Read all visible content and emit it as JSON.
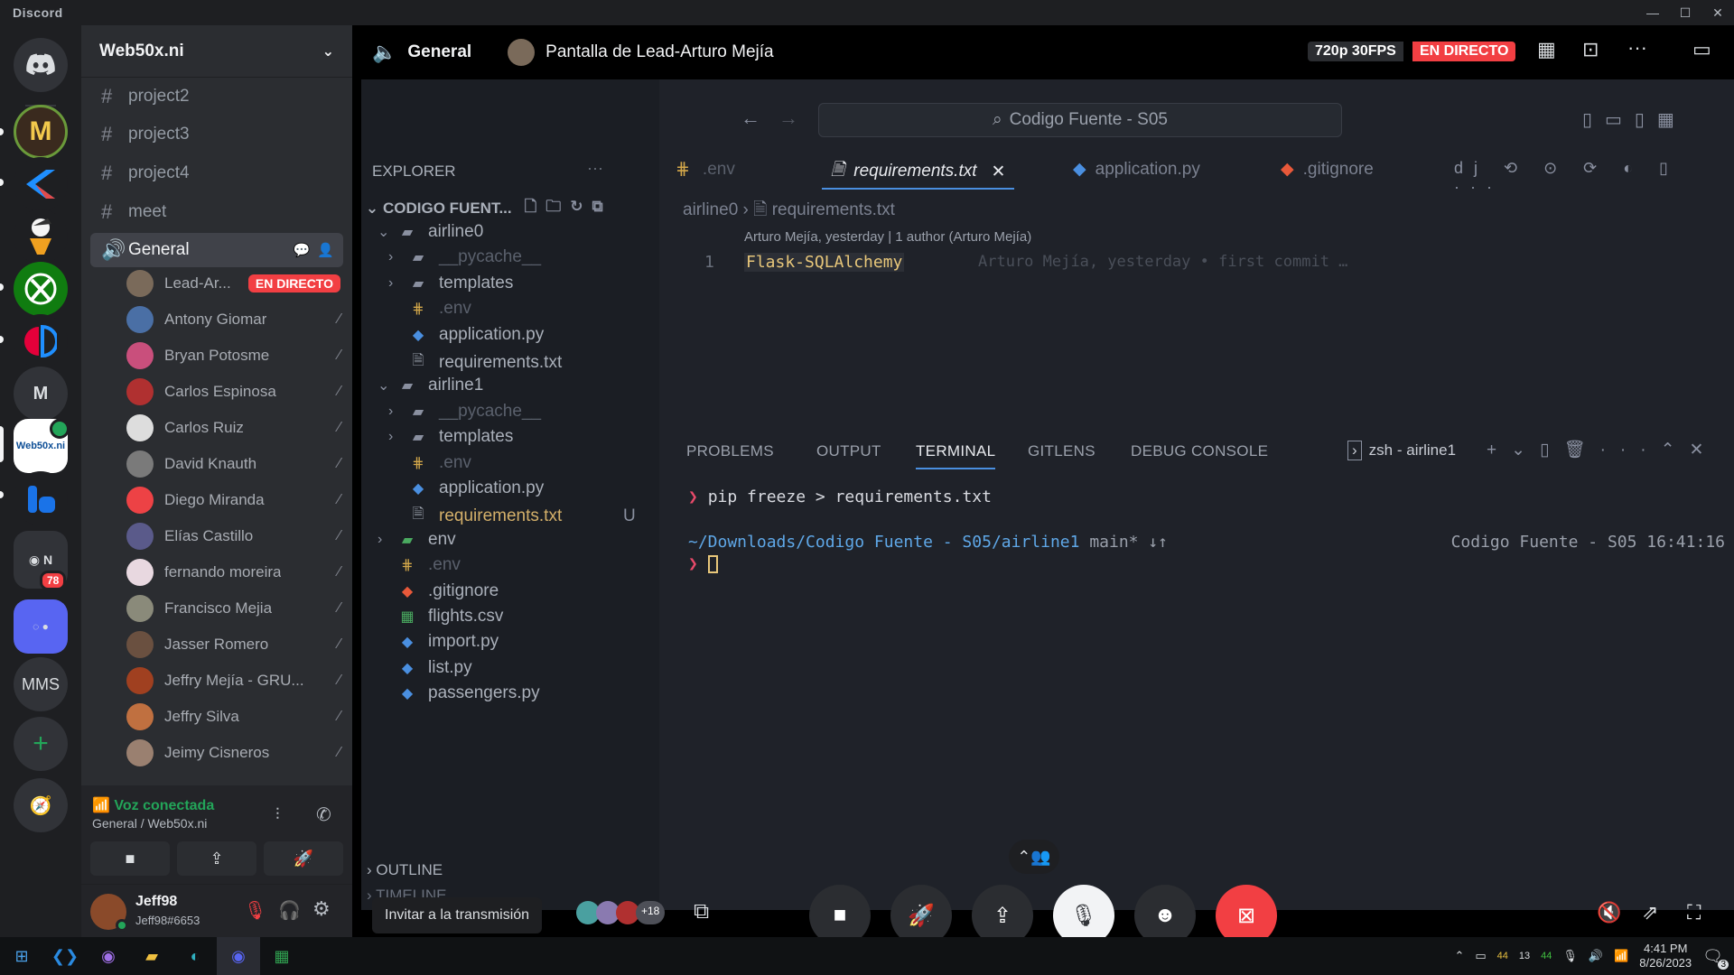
{
  "app": {
    "title": "Discord"
  },
  "guilds": {
    "items": [
      {
        "label": "",
        "color": "#5865f2"
      },
      {
        "label": "M",
        "color": "#2b2d31"
      },
      {
        "label": "",
        "color": "#1f6feb"
      },
      {
        "label": "",
        "color": "#f5f5f5"
      },
      {
        "label": "",
        "color": "#107c10"
      },
      {
        "label": "",
        "color": "#e4003a"
      },
      {
        "label": "M",
        "color": "#313338"
      },
      {
        "label": "Web50x.ni",
        "color": "#ffffff"
      },
      {
        "label": "",
        "color": "#1a73e8"
      },
      {
        "label": "",
        "color": "#313338"
      },
      {
        "label": "",
        "color": "#5865f2"
      },
      {
        "label": "MMS",
        "color": "#313338"
      }
    ],
    "folder_badge": "78"
  },
  "server": {
    "name": "Web50x.ni",
    "text_channels": [
      "project2",
      "project3",
      "project4",
      "meet"
    ],
    "voice_channel": "General",
    "voice_users": [
      {
        "name": "Lead-Ar...",
        "live": "EN DIRECTO",
        "color": "#7a6a5a"
      },
      {
        "name": "Antony Giomar",
        "color": "#4a6fa5"
      },
      {
        "name": "Bryan Potosme",
        "color": "#c94f7c"
      },
      {
        "name": "Carlos Espinosa",
        "color": "#b03030"
      },
      {
        "name": "Carlos Ruiz",
        "color": "#dddddd"
      },
      {
        "name": "David Knauth",
        "color": "#7a7a7a"
      },
      {
        "name": "Diego Miranda",
        "color": "#ed4245"
      },
      {
        "name": "Elías Castillo",
        "color": "#5a5a8a"
      },
      {
        "name": "fernando moreira",
        "color": "#e8d8e0"
      },
      {
        "name": "Francisco Mejia",
        "color": "#8a8a7a"
      },
      {
        "name": "Jasser Romero",
        "color": "#6a5040"
      },
      {
        "name": "Jeffry Mejía - GRU...",
        "color": "#a04020"
      },
      {
        "name": "Jeffry Silva",
        "color": "#c07040"
      },
      {
        "name": "Jeimy Cisneros",
        "color": "#9a8070"
      }
    ]
  },
  "voice_panel": {
    "status": "Voz conectada",
    "location": "General / Web50x.ni"
  },
  "user": {
    "name": "Jeff98",
    "tag": "Jeff98#6653"
  },
  "stream_header": {
    "channel": "General",
    "title": "Pantalla de Lead-Arturo Mejía",
    "quality": "720p 30FPS",
    "live": "EN DIRECTO"
  },
  "vscode": {
    "search": "Codigo Fuente - S05",
    "explorer_title": "EXPLORER",
    "root": "CODIGO FUENT...",
    "tree": [
      {
        "name": "airline0",
        "icon": "folder",
        "indent": 1,
        "chev": "v"
      },
      {
        "name": "__pycache__",
        "icon": "folder",
        "indent": 2,
        "chev": ">",
        "dim": true
      },
      {
        "name": "templates",
        "icon": "folder",
        "indent": 2,
        "chev": ">"
      },
      {
        "name": ".env",
        "icon": "env",
        "indent": 2,
        "dim": true
      },
      {
        "name": "application.py",
        "icon": "py",
        "indent": 2
      },
      {
        "name": "requirements.txt",
        "icon": "txt",
        "indent": 2
      },
      {
        "name": "airline1",
        "icon": "folder",
        "indent": 1,
        "chev": "v"
      },
      {
        "name": "__pycache__",
        "icon": "folder",
        "indent": 2,
        "chev": ">",
        "dim": true
      },
      {
        "name": "templates",
        "icon": "folder",
        "indent": 2,
        "chev": ">"
      },
      {
        "name": ".env",
        "icon": "env",
        "indent": 2,
        "dim": true
      },
      {
        "name": "application.py",
        "icon": "py",
        "indent": 2
      },
      {
        "name": "requirements.txt",
        "icon": "txt",
        "indent": 2,
        "status": "U",
        "modified": true
      },
      {
        "name": "env",
        "icon": "folder-green",
        "indent": 1,
        "chev": ">"
      },
      {
        "name": ".env",
        "icon": "env",
        "indent": 1,
        "dim": true
      },
      {
        "name": ".gitignore",
        "icon": "git",
        "indent": 1
      },
      {
        "name": "flights.csv",
        "icon": "csv",
        "indent": 1
      },
      {
        "name": "import.py",
        "icon": "py",
        "indent": 1
      },
      {
        "name": "list.py",
        "icon": "py",
        "indent": 1
      },
      {
        "name": "passengers.py",
        "icon": "py",
        "indent": 1
      }
    ],
    "outline": "OUTLINE",
    "timeline": "TIMELINE",
    "tabs": [
      ".env",
      "requirements.txt",
      "application.py",
      ".gitignore"
    ],
    "breadcrumb": [
      "airline0",
      "requirements.txt"
    ],
    "blame_header": "Arturo Mejía, yesterday | 1 author (Arturo Mejía)",
    "line_number": "1",
    "code_line": "Flask-SQLAlchemy",
    "inline_blame": "Arturo Mejía, yesterday • first commit …",
    "panel_tabs": [
      "PROBLEMS",
      "OUTPUT",
      "TERMINAL",
      "GITLENS",
      "DEBUG CONSOLE"
    ],
    "terminal_name": "zsh - airline1",
    "terminal_cmd": "pip freeze > requirements.txt",
    "terminal_path": "~/Downloads/Codigo Fuente - S05/airline1",
    "terminal_branch": "main* ↓↑",
    "terminal_right": "Codigo Fuente - S05 16:41:16"
  },
  "callbar": {
    "invite": "Invitar a la transmisión",
    "more_viewers": "+18"
  },
  "taskbar": {
    "time": "4:41 PM",
    "date": "8/26/2023",
    "notif": "3",
    "tray_a": "44",
    "tray_b": "13",
    "tray_c": "44"
  },
  "colors": {
    "live": "#f23f43",
    "online": "#23a559",
    "blurple": "#5865f2"
  }
}
